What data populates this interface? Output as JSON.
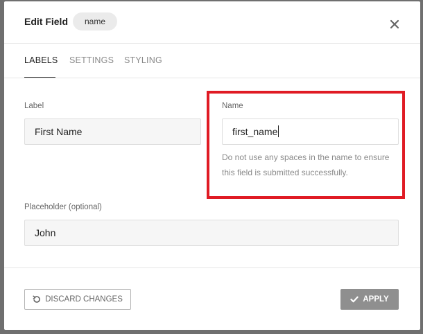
{
  "dialog": {
    "title": "Edit Field",
    "badge": "name"
  },
  "tabs": [
    {
      "label": "LABELS",
      "active": true
    },
    {
      "label": "SETTINGS",
      "active": false
    },
    {
      "label": "STYLING",
      "active": false
    }
  ],
  "fields": {
    "label": {
      "label": "Label",
      "value": "First Name"
    },
    "name": {
      "label": "Name",
      "value": "first_name",
      "help": "Do not use any spaces in the name to ensure this field is submitted successfully."
    },
    "placeholder": {
      "label": "Placeholder (optional)",
      "value": "John"
    }
  },
  "actions": {
    "discard_label": "DISCARD CHANGES",
    "apply_label": "APPLY"
  },
  "icons": {
    "close": "close-icon",
    "discard": "undo-icon",
    "apply": "checkmark-icon"
  },
  "colors": {
    "highlight": "#e01b24",
    "apply_button": "#8f8f8f",
    "overlay": "#6f6f6f"
  }
}
